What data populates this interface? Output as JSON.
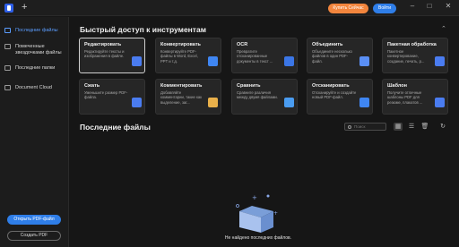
{
  "titlebar": {
    "new_tab": "+",
    "buy_label": "Купить Сейчас",
    "login_label": "Войти",
    "minimize": "–",
    "maximize": "□",
    "close": "✕"
  },
  "sidebar": {
    "items": [
      {
        "label": "Последние файлы",
        "active": true
      },
      {
        "label": "Помеченные звездочками файлы"
      },
      {
        "label": "Последние папки"
      },
      {
        "label": "Document Cloud"
      }
    ],
    "open_pdf": "Открыть PDF-файл",
    "create_pdf": "Создать PDF"
  },
  "quick_access": {
    "title": "Быстрый доступ к инструментам",
    "collapse_icon": "⌃",
    "cards": [
      {
        "title": "Редактировать",
        "desc": "Редактируйте тексты и изображения в файле.",
        "icon_color": "#4a7cf0"
      },
      {
        "title": "Конвертировать",
        "desc": "Конвертируйте PDF-файлы в Word, Excel, PPT и т.д.",
        "icon_color": "#3f86f2"
      },
      {
        "title": "OCR",
        "desc": "Превратите отсканированные документы в текст ...",
        "icon_color": "#3b76e6"
      },
      {
        "title": "Объединить",
        "desc": "Объедините несколько файлов в один PDF-файл.",
        "icon_color": "#5a8ff5"
      },
      {
        "title": "Пакетная обработка",
        "desc": "Пакетное конвертирование, создание, печать, р...",
        "icon_color": "#4a7cf0"
      },
      {
        "title": "Сжать",
        "desc": "Уменьшите размер PDF-файла.",
        "icon_color": "#4a7cf0"
      },
      {
        "title": "Комментировать",
        "desc": "Добавляйте комментарии, такие как выделение, заг...",
        "icon_color": "#e9b04a"
      },
      {
        "title": "Сравнить",
        "desc": "Сравните различия между двумя файлами.",
        "icon_color": "#4a9cf0"
      },
      {
        "title": "Отсканировать",
        "desc": "Отсканируйте и создайте новый PDF-файл.",
        "icon_color": "#3f86f2"
      },
      {
        "title": "Шаблон",
        "desc": "Получите отличные шаблоны PDF для резюме, плакатов ...",
        "icon_color": "#4a7cf0"
      }
    ]
  },
  "recent_files": {
    "title": "Последние файлы",
    "search_placeholder": "Поиск",
    "empty_text": "Не найдено последних файлов."
  }
}
